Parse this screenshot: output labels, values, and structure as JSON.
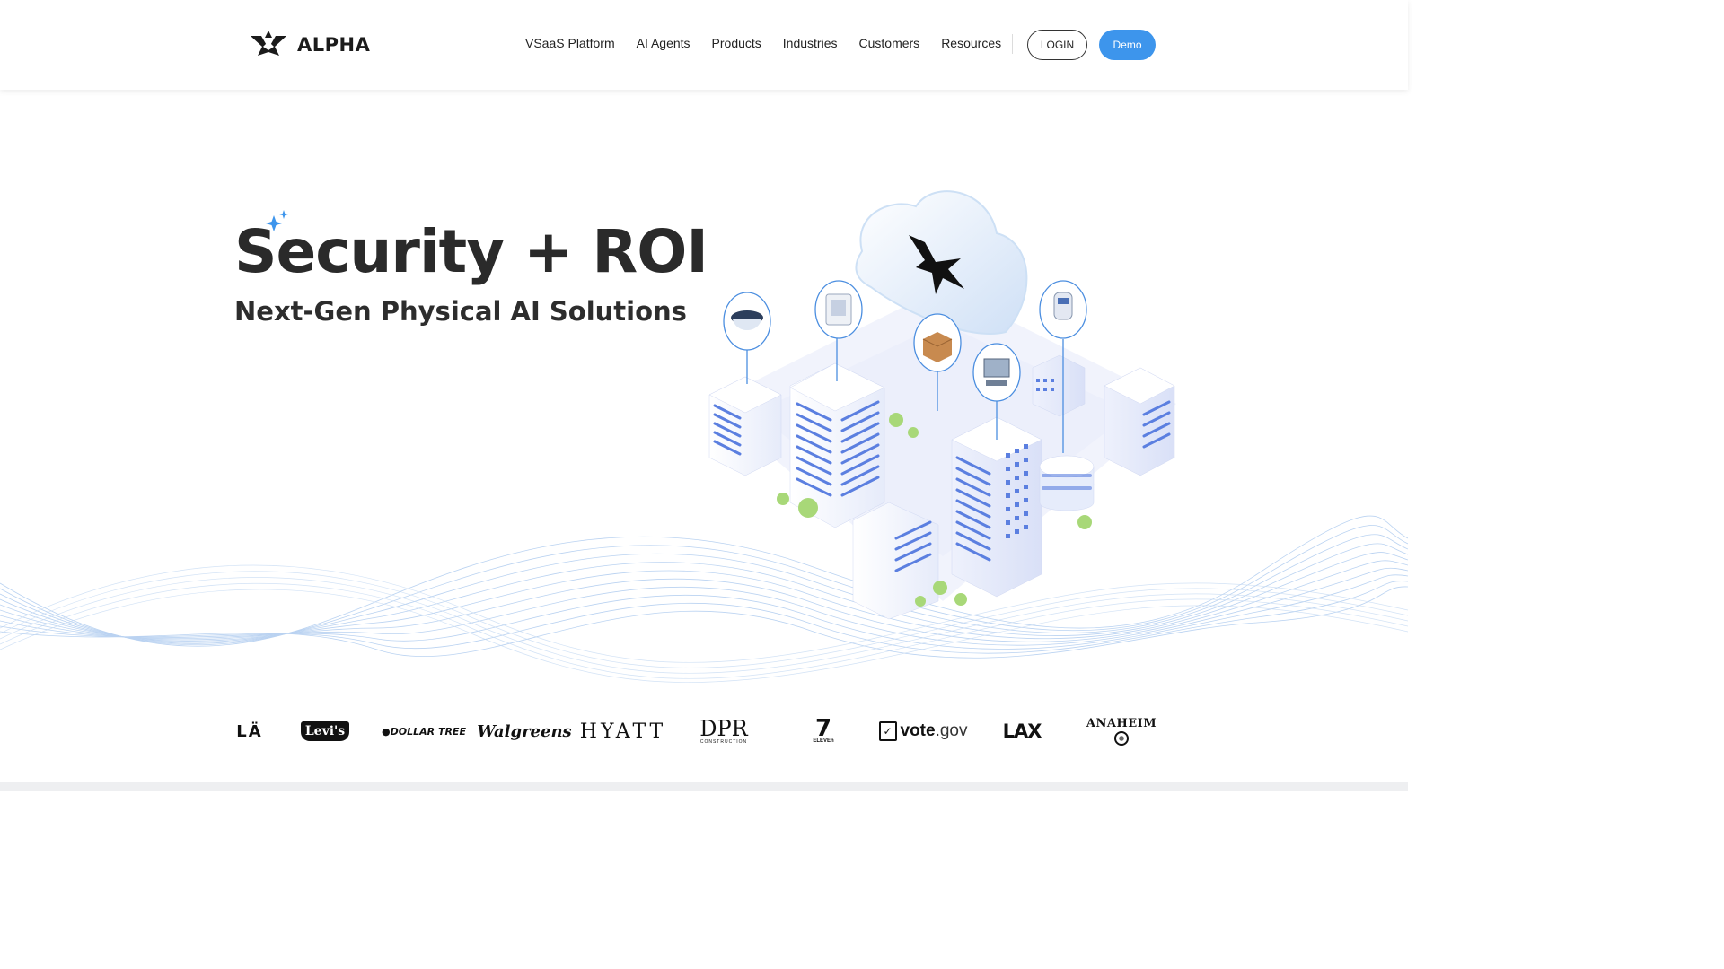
{
  "brand": {
    "name": "ALPHA",
    "logo_icon": "alpha-logo-mark"
  },
  "nav": {
    "items": [
      {
        "label": "VSaaS Platform"
      },
      {
        "label": "AI Agents"
      },
      {
        "label": "Products"
      },
      {
        "label": "Industries"
      },
      {
        "label": "Customers"
      },
      {
        "label": "Resources"
      }
    ],
    "login_label": "LOGIN",
    "demo_label": "Demo"
  },
  "hero": {
    "title": "Security + ROI",
    "subtitle": "Next-Gen Physical AI Solutions"
  },
  "customer_logos": {
    "la": "LÄ",
    "levis": "Levi's",
    "dollar_tree": "DOLLAR TREE",
    "walgreens": "Walgreens",
    "hyatt": "HYATT",
    "dpr": "DPR",
    "dpr_sub": "CONSTRUCTION",
    "seven": "7",
    "seven_sub": "ELEVEn",
    "vote_main": "vote",
    "vote_suffix": ".gov",
    "lax": "LAX",
    "anaheim": "ANAHEIM"
  },
  "colors": {
    "accent": "#3d95ec",
    "text_dark": "#2a2a2a",
    "illustration_blue": "#5b7fe0",
    "wave_blue": "#9cc0ea"
  }
}
